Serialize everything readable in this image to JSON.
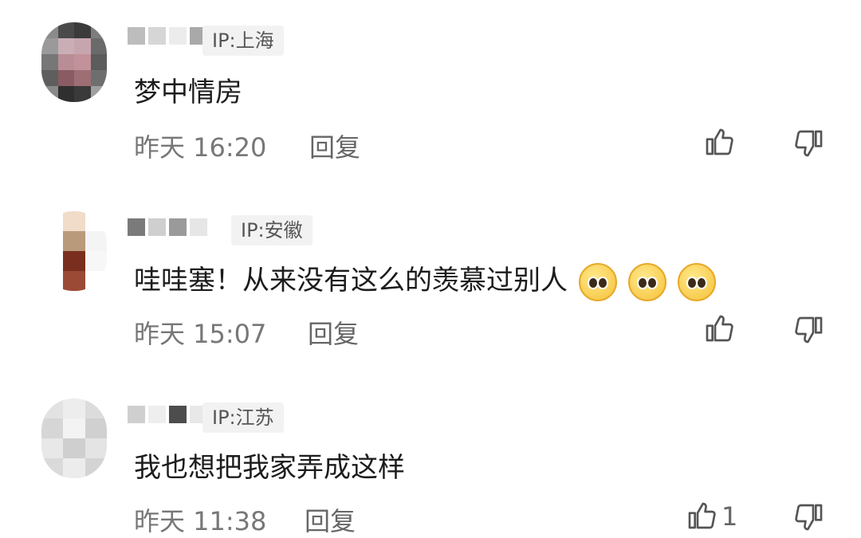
{
  "comments": [
    {
      "ip": "IP:上海",
      "text": "梦中情房",
      "time": "昨天 16:20",
      "reply": "回复",
      "emoji_count": 0,
      "likes": ""
    },
    {
      "ip": "IP:安徽",
      "text": "哇哇塞！从来没有这么的羡慕过别人",
      "time": "昨天 15:07",
      "reply": "回复",
      "emoji_count": 3,
      "likes": ""
    },
    {
      "ip": "IP:江苏",
      "text": "我也想把我家弄成这样",
      "time": "昨天 11:38",
      "reply": "回复",
      "emoji_count": 0,
      "likes": "1"
    }
  ],
  "icons": {
    "like": "thumbs-up-icon",
    "dislike": "thumbs-down-icon",
    "emoji": "pleading-face-icon"
  }
}
